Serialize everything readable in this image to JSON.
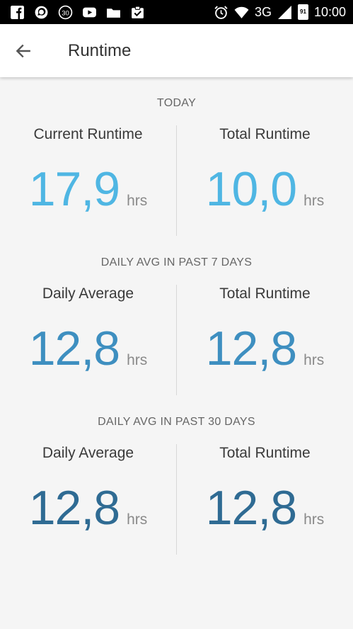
{
  "status_bar": {
    "left_icons": [
      "facebook-icon",
      "whatsapp-icon",
      "calendar-30-icon",
      "youtube-icon",
      "folder-icon",
      "clipboard-check-icon"
    ],
    "calendar_day": "30",
    "network": "3G",
    "battery": "91",
    "time": "10:00"
  },
  "app_bar": {
    "title": "Runtime"
  },
  "sections": [
    {
      "heading": "TODAY",
      "left": {
        "label": "Current Runtime",
        "value": "17,9",
        "unit": "hrs"
      },
      "right": {
        "label": "Total Runtime",
        "value": "10,0",
        "unit": "hrs"
      },
      "color": "#4fb6e3"
    },
    {
      "heading": "DAILY AVG IN PAST 7 DAYS",
      "left": {
        "label": "Daily Average",
        "value": "12,8",
        "unit": "hrs"
      },
      "right": {
        "label": "Total Runtime",
        "value": "12,8",
        "unit": "hrs"
      },
      "color": "#3e8fc0"
    },
    {
      "heading": "DAILY AVG IN PAST 30 DAYS",
      "left": {
        "label": "Daily Average",
        "value": "12,8",
        "unit": "hrs"
      },
      "right": {
        "label": "Total Runtime",
        "value": "12,8",
        "unit": "hrs"
      },
      "color": "#2f6b93"
    }
  ]
}
